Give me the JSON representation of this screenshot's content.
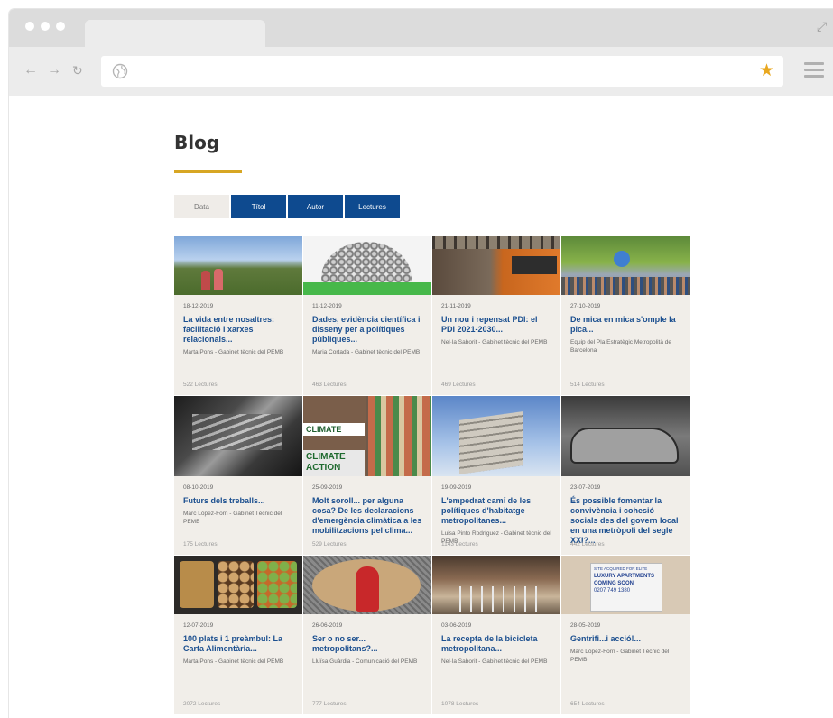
{
  "browser": {
    "address": ""
  },
  "blog": {
    "title": "Blog",
    "sort_tabs": [
      {
        "label": "Data"
      },
      {
        "label": "Títol"
      },
      {
        "label": "Autor"
      },
      {
        "label": "Lectures"
      }
    ],
    "posts": [
      {
        "date": "18-12-2019",
        "title": "La vida entre nosaltres: facilitació i xarxes relacionals...",
        "author": "Marta Pons - Gabinet tècnic del PEMB",
        "reads": "522 Lectures"
      },
      {
        "date": "11-12-2019",
        "title": "Dades, evidència científica i disseny per a polítiques públiques...",
        "author": "Maria Cortada - Gabinet tècnic del PEMB",
        "reads": "463 Lectures"
      },
      {
        "date": "21-11-2019",
        "title": "Un nou i repensat PDI: el PDI 2021-2030...",
        "author": "Nel·la Saborit - Gabinet tècnic del PEMB",
        "reads": "469 Lectures"
      },
      {
        "date": "27-10-2019",
        "title": "De mica en mica s'omple la pica...",
        "author": "Equip del Pla Estratègic Metropolità de Barcelona",
        "reads": "514 Lectures"
      },
      {
        "date": "08-10-2019",
        "title": "Futurs dels treballs...",
        "author": "Marc López-Forn - Gabinet Tècnic del PEMB",
        "reads": "175 Lectures"
      },
      {
        "date": "25-09-2019",
        "title": "Molt soroll... per alguna cosa? De les declaracions d'emergència climàtica a les mobilitzacions pel clima...",
        "author": "",
        "reads": "529 Lectures"
      },
      {
        "date": "19-09-2019",
        "title": "L'empedrat camí de les polítiques d'habitatge metropolitanes...",
        "author": "Luisa Pinto Rodríguez - Gabinet tècnic del PEMB",
        "reads": "1143 Lectures"
      },
      {
        "date": "23-07-2019",
        "title": "És possible fomentar la convivència i cohesió socials des del govern local en una metròpoli del segle XXI?...",
        "author": "",
        "reads": "442 Lectures"
      },
      {
        "date": "12-07-2019",
        "title": "100 plats i 1 preàmbul: La Carta Alimentària...",
        "author": "Marta Pons - Gabinet tècnic del PEMB",
        "reads": "2072 Lectures"
      },
      {
        "date": "26-06-2019",
        "title": "Ser o no ser... metropolitans?...",
        "author": "Lluïsa Guàrdia - Comunicació del PEMB",
        "reads": "777 Lectures"
      },
      {
        "date": "03-06-2019",
        "title": "La recepta de la bicicleta metropolitana...",
        "author": "Nel·la Saborit - Gabinet tècnic del PEMB",
        "reads": "1078 Lectures"
      },
      {
        "date": "28-05-2019",
        "title": "Gentrifi...i acció!...",
        "author": "Marc López-Forn - Gabinet Tècnic del PEMB",
        "reads": "654 Lectures"
      }
    ],
    "thumb_texts": {
      "climate_1": "CLIMATE",
      "climate_2": "CLIMATE ACTION",
      "sign_1": "SITE ACQUIRED FOR ELITE",
      "sign_2": "LUXURY APARTMENTS",
      "sign_3": "COMING SOON",
      "sign_4": "0207 749 1380"
    }
  },
  "colors": {
    "accent_gold": "#d7a623",
    "tab_blue": "#0e4a8f",
    "title_blue": "#1b4f8f",
    "card_bg": "#f1eee9"
  },
  "icons": [
    "back-arrow-icon",
    "forward-arrow-icon",
    "reload-icon",
    "globe-icon",
    "star-icon",
    "menu-icon",
    "expand-icon"
  ]
}
